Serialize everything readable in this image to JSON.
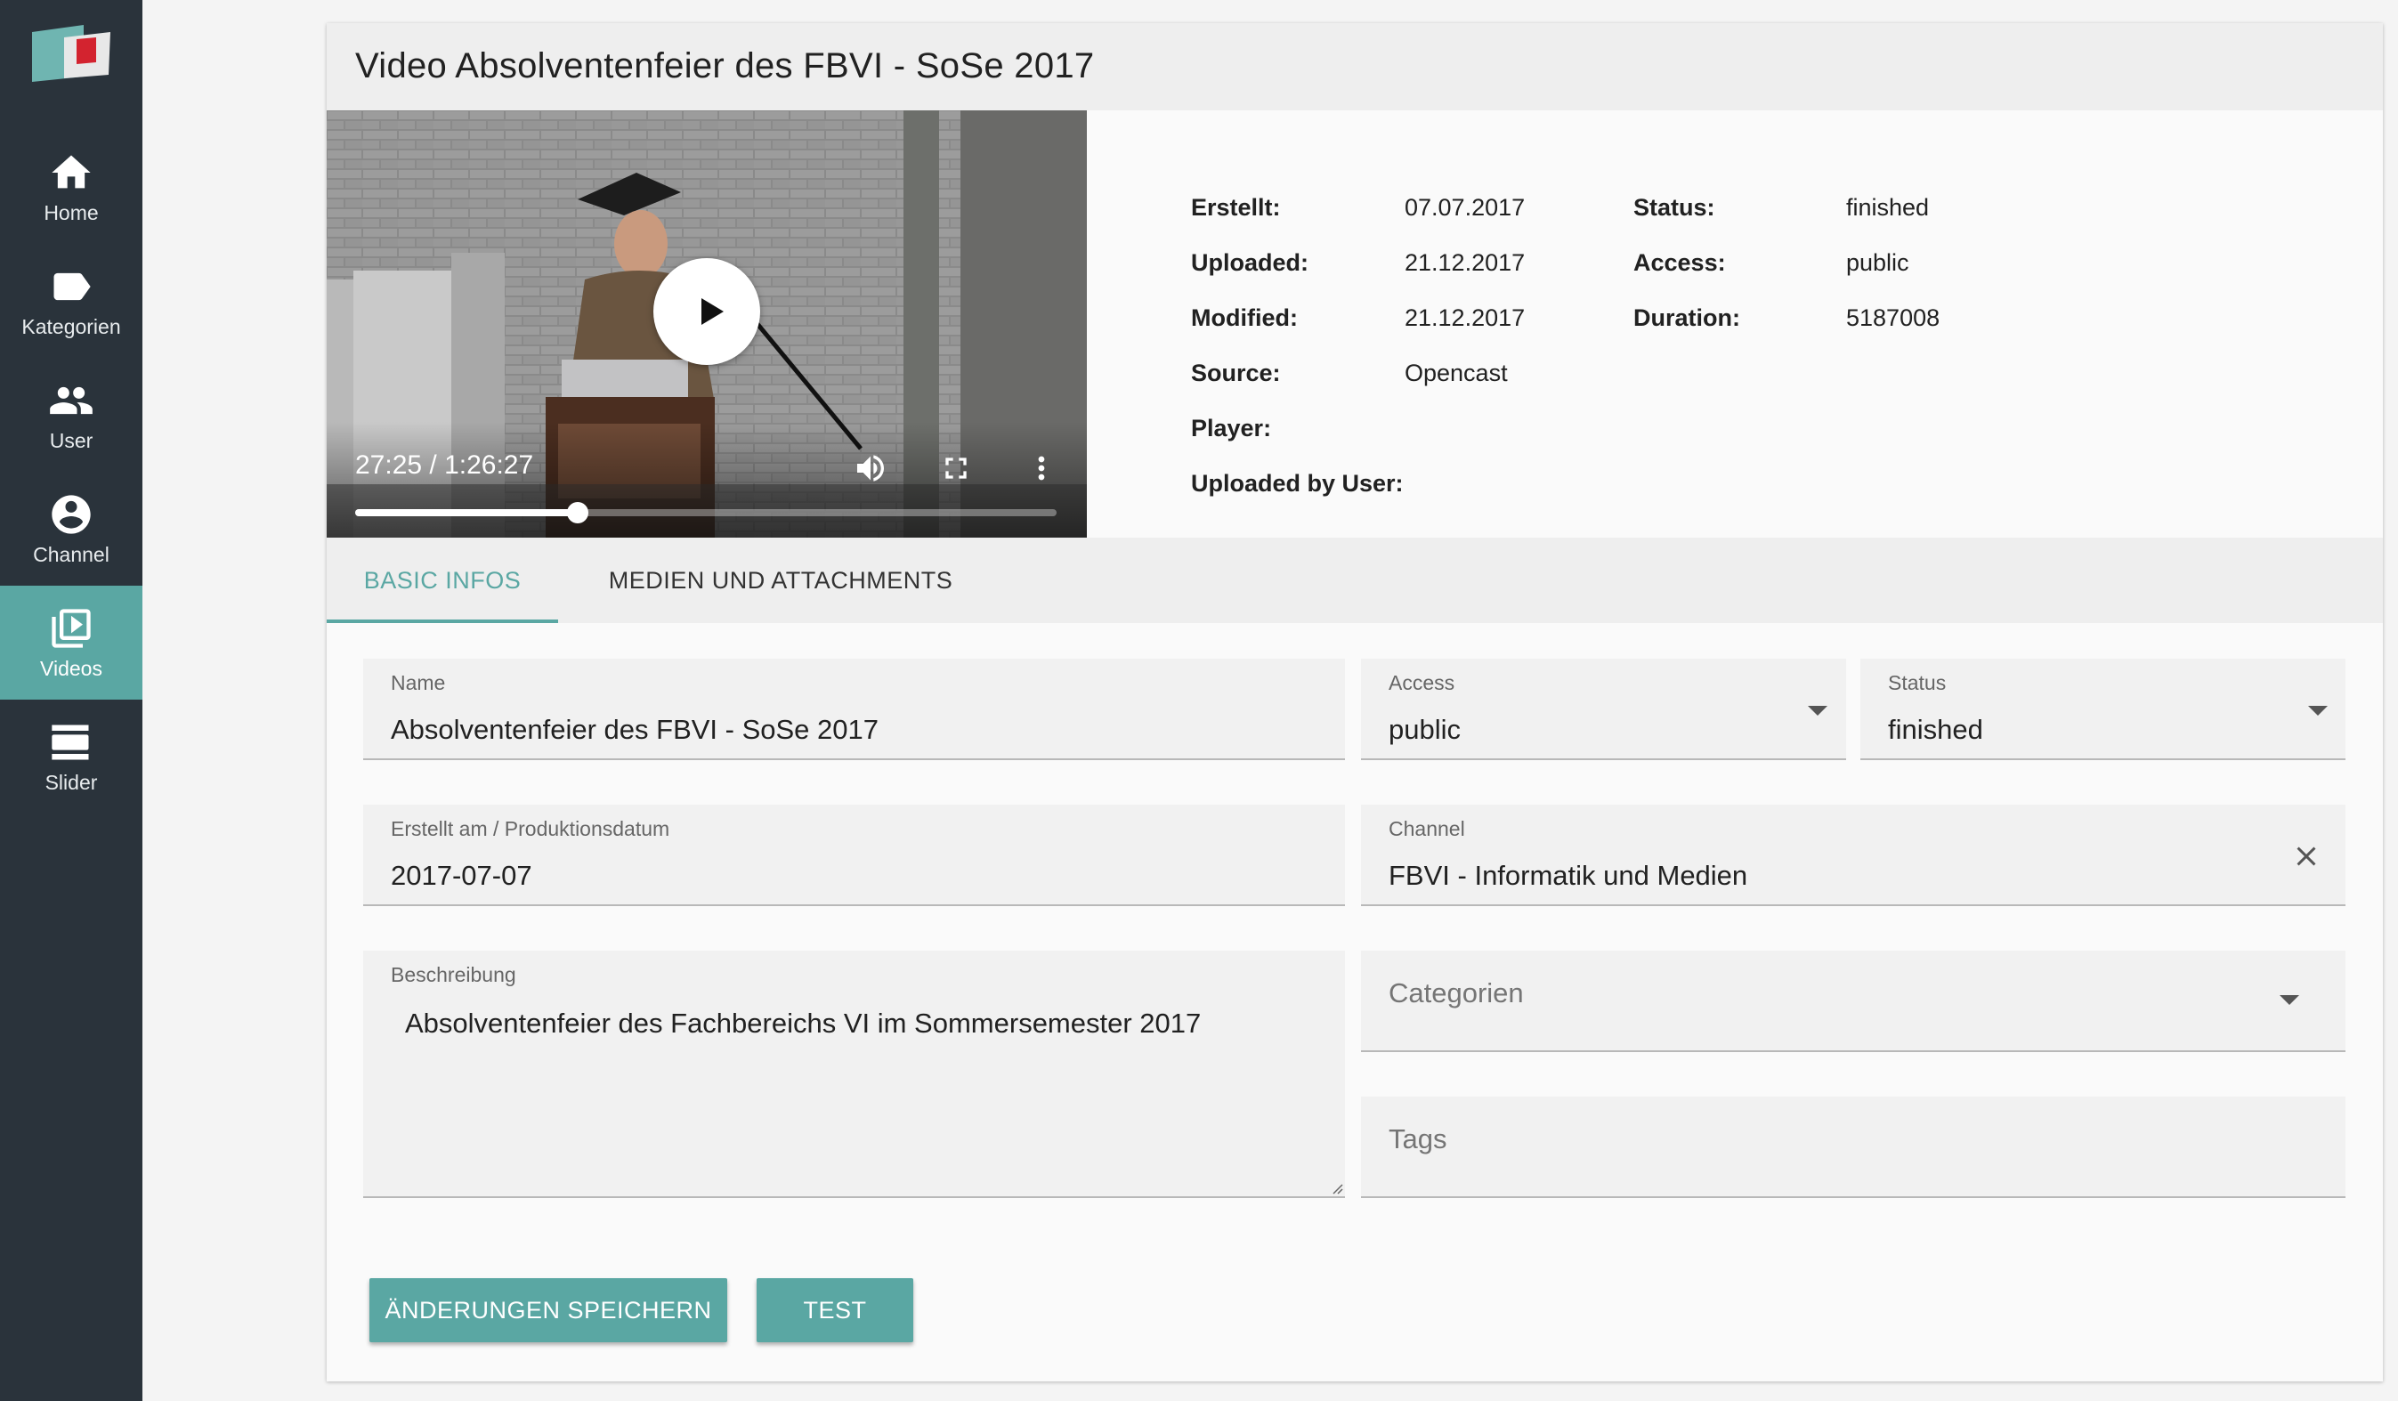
{
  "colors": {
    "accent": "#5aa7a3",
    "sidebar": "#2a333b"
  },
  "sidebar": {
    "items": [
      {
        "label": "Home",
        "icon": "home-icon"
      },
      {
        "label": "Kategorien",
        "icon": "label-icon"
      },
      {
        "label": "User",
        "icon": "people-icon"
      },
      {
        "label": "Channel",
        "icon": "account-circle-icon"
      },
      {
        "label": "Videos",
        "icon": "video-library-icon",
        "active": true
      },
      {
        "label": "Slider",
        "icon": "view-day-icon"
      }
    ]
  },
  "page": {
    "title": "Video Absolventenfeier des FBVI - SoSe 2017"
  },
  "video": {
    "time": "27:25 / 1:26:27",
    "progress": 0.317
  },
  "meta": {
    "created_label": "Erstellt:",
    "created": "07.07.2017",
    "uploaded_label": "Uploaded:",
    "uploaded": "21.12.2017",
    "modified_label": "Modified:",
    "modified": "21.12.2017",
    "source_label": "Source:",
    "source": "Opencast",
    "player_label": "Player:",
    "uploaded_by_label": "Uploaded by User:",
    "status_label": "Status:",
    "status": "finished",
    "access_label": "Access:",
    "access": "public",
    "duration_label": "Duration:",
    "duration": "5187008"
  },
  "tabs": [
    {
      "label": "BASIC INFOS",
      "active": true
    },
    {
      "label": "MEDIEN UND ATTACHMENTS"
    }
  ],
  "form": {
    "name": {
      "label": "Name",
      "value": "Absolventenfeier des FBVI - SoSe 2017"
    },
    "access": {
      "label": "Access",
      "value": "public"
    },
    "status": {
      "label": "Status",
      "value": "finished"
    },
    "date": {
      "label": "Erstellt am / Produktionsdatum",
      "value": "2017-07-07"
    },
    "channel": {
      "label": "Channel",
      "value": "FBVI - Informatik und Medien"
    },
    "description": {
      "label": "Beschreibung",
      "value": "Absolventenfeier des Fachbereichs VI im Sommersemester 2017"
    },
    "categories": {
      "placeholder": "Categorien"
    },
    "tags": {
      "placeholder": "Tags"
    }
  },
  "buttons": {
    "save": "ÄNDERUNGEN SPEICHERN",
    "test": "TEST"
  }
}
